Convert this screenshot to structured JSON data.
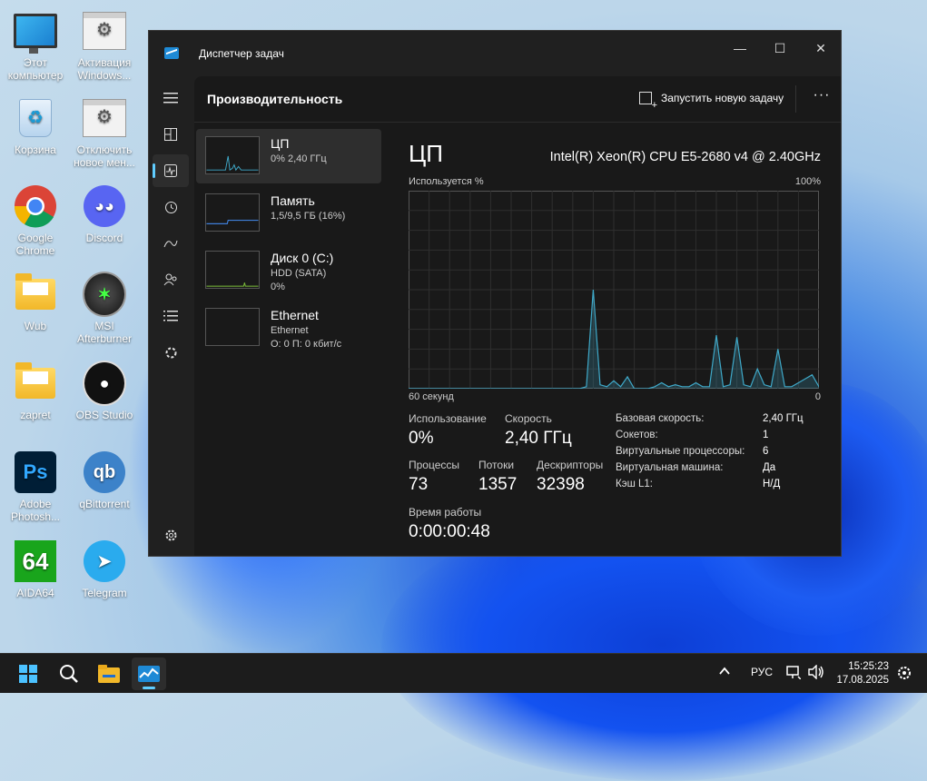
{
  "desktop": {
    "icons": [
      {
        "label": "Этот компьютер",
        "icon": "monitor-icon"
      },
      {
        "label": "Активация Windows...",
        "icon": "settings-app-icon"
      },
      {
        "label": "Корзина",
        "icon": "recycle-bin-icon"
      },
      {
        "label": "Отключить новое мен...",
        "icon": "settings-app-icon"
      },
      {
        "label": "Google Chrome",
        "icon": "chrome-icon"
      },
      {
        "label": "Discord",
        "icon": "discord-icon"
      },
      {
        "label": "Wub",
        "icon": "folder-icon"
      },
      {
        "label": "MSI Afterburner",
        "icon": "msi-afterburner-icon"
      },
      {
        "label": "zapret",
        "icon": "folder-icon"
      },
      {
        "label": "OBS Studio",
        "icon": "obs-icon"
      },
      {
        "label": "Adobe Photosh...",
        "icon": "photoshop-icon",
        "badge": "Ps"
      },
      {
        "label": "qBittorrent",
        "icon": "qbittorrent-icon",
        "badge": "qb"
      },
      {
        "label": "AIDA64",
        "icon": "aida64-icon",
        "badge": "64"
      },
      {
        "label": "Telegram",
        "icon": "telegram-icon"
      }
    ]
  },
  "window": {
    "title": "Диспетчер задач",
    "controls": {
      "minimize": "—",
      "maximize": "☐",
      "close": "✕"
    }
  },
  "header": {
    "page_title": "Производительность",
    "run_task_label": "Запустить новую задачу",
    "more_label": "···"
  },
  "resources": [
    {
      "name": "ЦП",
      "line1": "0%  2,40 ГГц",
      "line2": ""
    },
    {
      "name": "Память",
      "line1": "1,5/9,5 ГБ (16%)",
      "line2": ""
    },
    {
      "name": "Диск 0 (C:)",
      "line1": "HDD (SATA)",
      "line2": "0%"
    },
    {
      "name": "Ethernet",
      "line1": "Ethernet",
      "line2": "О: 0 П: 0 кбит/с"
    }
  ],
  "cpu": {
    "title": "ЦП",
    "model": "Intel(R) Xeon(R) CPU E5-2680 v4 @ 2.40GHz",
    "graph_label_left": "Используется %",
    "graph_label_right": "100%",
    "axis_left": "60 секунд",
    "axis_right": "0",
    "usage_label": "Использование",
    "usage_value": "0%",
    "speed_label": "Скорость",
    "speed_value": "2,40 ГГц",
    "processes_label": "Процессы",
    "processes_value": "73",
    "threads_label": "Потоки",
    "threads_value": "1357",
    "handles_label": "Дескрипторы",
    "handles_value": "32398",
    "uptime_label": "Время работы",
    "uptime_value": "0:00:00:48",
    "details": [
      {
        "k": "Базовая скорость:",
        "v": "2,40 ГГц"
      },
      {
        "k": "Сокетов:",
        "v": "1"
      },
      {
        "k": "Виртуальные процессоры:",
        "v": "6"
      },
      {
        "k": "Виртуальная машина:",
        "v": "Да"
      },
      {
        "k": "Кэш L1:",
        "v": "Н/Д"
      }
    ]
  },
  "chart_data": {
    "type": "area",
    "ylabel": "Используется %",
    "xlabel": "60 секунд",
    "ylim": [
      0,
      100
    ],
    "x": [
      60,
      59,
      58,
      57,
      56,
      55,
      54,
      53,
      52,
      51,
      50,
      49,
      48,
      47,
      46,
      45,
      44,
      43,
      42,
      41,
      40,
      39,
      38,
      37,
      36,
      35,
      34,
      33,
      32,
      31,
      30,
      29,
      28,
      27,
      26,
      25,
      24,
      23,
      22,
      21,
      20,
      19,
      18,
      17,
      16,
      15,
      14,
      13,
      12,
      11,
      10,
      9,
      8,
      7,
      6,
      5,
      4,
      3,
      2,
      1,
      0
    ],
    "values": [
      0,
      0,
      0,
      0,
      0,
      0,
      0,
      0,
      0,
      0,
      0,
      0,
      0,
      0,
      0,
      0,
      0,
      0,
      0,
      0,
      0,
      0,
      0,
      0,
      0,
      0,
      1,
      50,
      2,
      1,
      4,
      1,
      6,
      0,
      0,
      0,
      1,
      3,
      1,
      2,
      1,
      1,
      3,
      1,
      1,
      27,
      1,
      2,
      26,
      2,
      1,
      10,
      2,
      1,
      20,
      1,
      1,
      3,
      5,
      7,
      1
    ],
    "grid": true,
    "color": "#3fa9c9"
  },
  "taskbar": {
    "apps": [
      "start-icon",
      "search-icon",
      "file-explorer-icon",
      "task-manager-icon"
    ],
    "language": "РУС",
    "time": "15:25:23",
    "date": "17.08.2025"
  }
}
